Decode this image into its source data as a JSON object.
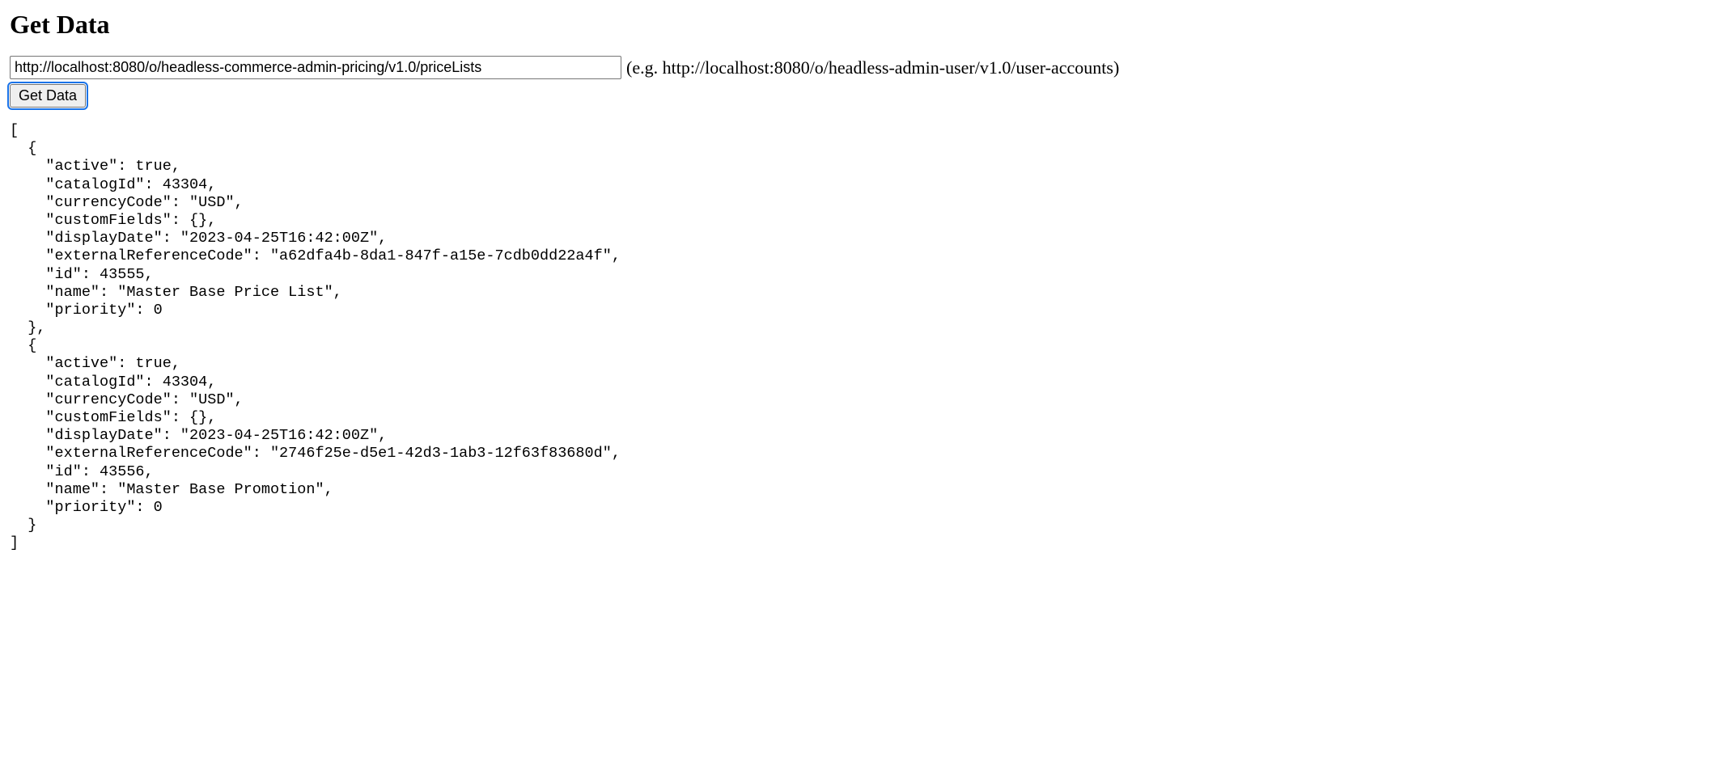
{
  "heading": "Get Data",
  "form": {
    "url_value": "http://localhost:8080/o/headless-commerce-admin-pricing/v1.0/priceLists",
    "hint": "(e.g. http://localhost:8080/o/headless-admin-user/v1.0/user-accounts)",
    "button_label": "Get Data"
  },
  "output": "[\n  {\n    \"active\": true,\n    \"catalogId\": 43304,\n    \"currencyCode\": \"USD\",\n    \"customFields\": {},\n    \"displayDate\": \"2023-04-25T16:42:00Z\",\n    \"externalReferenceCode\": \"a62dfa4b-8da1-847f-a15e-7cdb0dd22a4f\",\n    \"id\": 43555,\n    \"name\": \"Master Base Price List\",\n    \"priority\": 0\n  },\n  {\n    \"active\": true,\n    \"catalogId\": 43304,\n    \"currencyCode\": \"USD\",\n    \"customFields\": {},\n    \"displayDate\": \"2023-04-25T16:42:00Z\",\n    \"externalReferenceCode\": \"2746f25e-d5e1-42d3-1ab3-12f63f83680d\",\n    \"id\": 43556,\n    \"name\": \"Master Base Promotion\",\n    \"priority\": 0\n  }\n]"
}
